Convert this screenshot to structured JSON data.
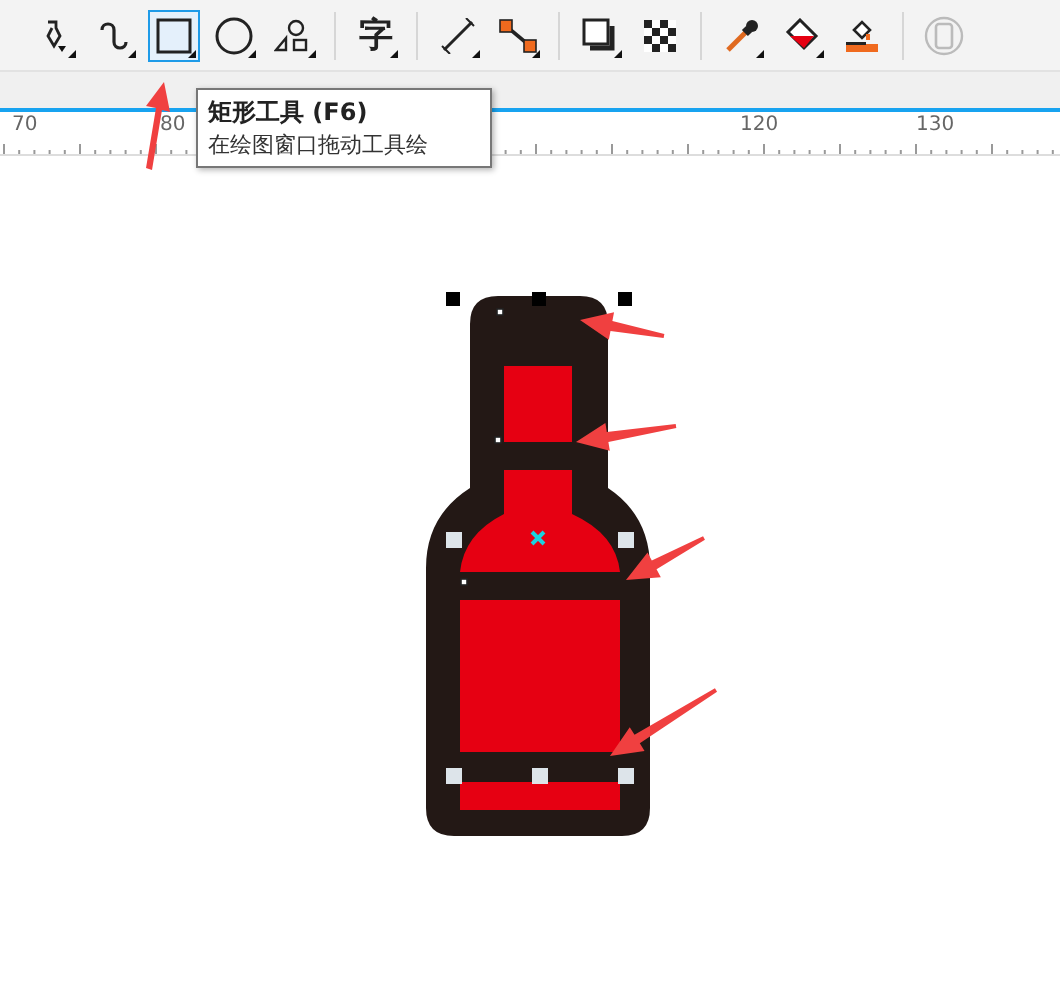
{
  "toolbar": {
    "tools": [
      {
        "kind": "pen",
        "selected": false
      },
      {
        "kind": "curve",
        "selected": false
      },
      {
        "kind": "rectangle",
        "selected": true
      },
      {
        "kind": "ellipse",
        "selected": false
      },
      {
        "kind": "shapes",
        "selected": false
      },
      {
        "kind": "text",
        "label": "字",
        "selected": false
      },
      {
        "kind": "line",
        "selected": false
      },
      {
        "kind": "connector",
        "selected": false
      },
      {
        "kind": "shadow",
        "selected": false
      },
      {
        "kind": "transparency",
        "selected": false
      },
      {
        "kind": "eyedropper",
        "selected": false
      },
      {
        "kind": "fill",
        "selected": false
      },
      {
        "kind": "outline",
        "selected": false
      },
      {
        "kind": "frame",
        "selected": false
      }
    ]
  },
  "tooltip": {
    "title": "矩形工具 (F6)",
    "description": "在绘图窗口拖动工具绘"
  },
  "ruler": {
    "labels": [
      "70",
      "80",
      "120",
      "130"
    ]
  }
}
